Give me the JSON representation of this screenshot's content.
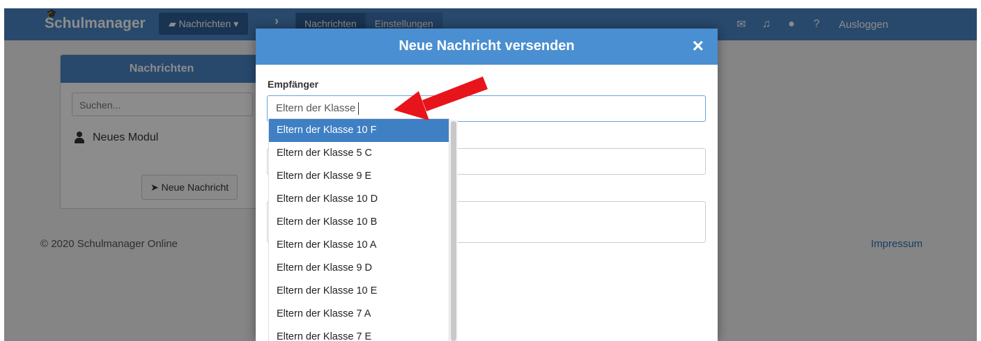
{
  "nav": {
    "brand": "Schulmanager",
    "module_dropdown": "Nachrichten ▾",
    "tabs": [
      "Nachrichten",
      "Einstellungen"
    ],
    "logout": "Ausloggen",
    "icons": [
      "envelope-icon",
      "bell-icon",
      "user-icon",
      "help-icon"
    ]
  },
  "panel": {
    "title": "Nachrichten",
    "search_placeholder": "Suchen...",
    "item": "Neues Modul",
    "new_message_button": "Neue Nachricht"
  },
  "footer": {
    "copyright": "© 2020 Schulmanager Online",
    "impressum": "Impressum"
  },
  "modal": {
    "title": "Neue Nachricht versenden",
    "close": "×",
    "recipient_label": "Empfänger",
    "recipient_value": "Eltern der Klasse",
    "suggestions": [
      "Eltern der Klasse 10 F",
      "Eltern der Klasse 5 C",
      "Eltern der Klasse 9 E",
      "Eltern der Klasse 10 D",
      "Eltern der Klasse 10 B",
      "Eltern der Klasse 10 A",
      "Eltern der Klasse 9 D",
      "Eltern der Klasse 10 E",
      "Eltern der Klasse 7 A",
      "Eltern der Klasse 7 E"
    ]
  },
  "colors": {
    "navbar": "#4a86c5",
    "modal_header": "#4a8fd1",
    "highlight": "#3f7fc4",
    "annotation_arrow": "#e8141b"
  }
}
